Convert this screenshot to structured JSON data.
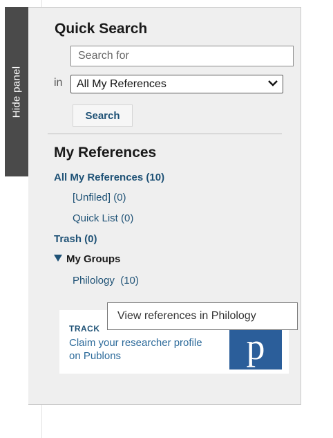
{
  "hide_panel": {
    "label": "Hide panel"
  },
  "quick_search": {
    "title": "Quick Search",
    "placeholder": "Search for",
    "in_label": "in",
    "scope_selected": "All My References",
    "button_label": "Search"
  },
  "my_references": {
    "title": "My References",
    "all": "All My References (10)",
    "unfiled": "[Unfiled] (0)",
    "quick_list": "Quick List (0)",
    "trash": "Trash (0)",
    "groups_title": "My Groups",
    "groups": [
      {
        "label": "Philology  (10)"
      }
    ]
  },
  "promo": {
    "heading": "TRACK",
    "text": "Claim your researcher profile on Publons",
    "logo_letter": "p"
  },
  "tooltip": {
    "text": "View references in Philology"
  },
  "colors": {
    "link": "#1f5276",
    "panel_bg": "#efefef",
    "tab_bg": "#4a4a4a",
    "publons_blue": "#2b5e9a"
  }
}
